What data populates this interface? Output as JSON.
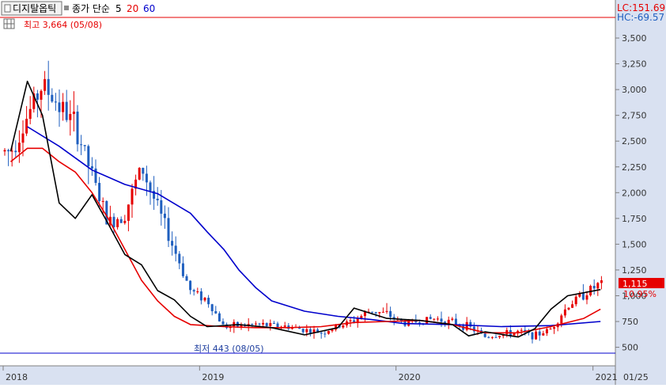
{
  "header": {
    "stock_name": "디지탈옵틱",
    "indicator_label": "종가 단순",
    "ma_periods": [
      "5",
      "20",
      "60"
    ],
    "lc_label": "LC:151.69",
    "hc_label": "HC:-69.57"
  },
  "annotations": {
    "high_label": "최고 3,664 (05/08)",
    "low_label": "최저 443 (08/05)",
    "current_price": "1,115",
    "current_change": "10.95%"
  },
  "colors": {
    "up": "#e60000",
    "down": "#1f5fbf",
    "ma5": "#000000",
    "ma20": "#e60000",
    "ma60": "#0000cc",
    "axis_bg": "#d9e1f1",
    "hc_color": "#1f5fbf"
  },
  "chart_data": {
    "type": "candlestick",
    "title": "",
    "yticks": [
      500,
      750,
      1000,
      1250,
      1500,
      1750,
      2000,
      2250,
      2500,
      2750,
      3000,
      3250,
      3500
    ],
    "ytick_labels": [
      "500",
      "750",
      "1,000",
      "1,250",
      "1,500",
      "1,750",
      "2,000",
      "2,250",
      "2,500",
      "2,750",
      "3,000",
      "3,250",
      "3,500"
    ],
    "ylim": [
      320,
      3700
    ],
    "x_labels": [
      "2018",
      "2019",
      "2020",
      "2021",
      "01/25"
    ],
    "high_value": 3664,
    "low_value": 443,
    "last_close": 1115,
    "series_close_key_points": [
      {
        "date": "2018-01",
        "close": 2400
      },
      {
        "date": "2018-03",
        "close": 3050
      },
      {
        "date": "2018-05",
        "close": 2650
      },
      {
        "date": "2018-07",
        "close": 1700
      },
      {
        "date": "2018-08",
        "close": 1800
      },
      {
        "date": "2018-09",
        "close": 2250
      },
      {
        "date": "2018-10",
        "close": 1850
      },
      {
        "date": "2018-11",
        "close": 1450
      },
      {
        "date": "2018-12",
        "close": 1050
      },
      {
        "date": "2019-01",
        "close": 960
      },
      {
        "date": "2019-02",
        "close": 700
      },
      {
        "date": "2019-04",
        "close": 720
      },
      {
        "date": "2019-06",
        "close": 700
      },
      {
        "date": "2019-08",
        "close": 640
      },
      {
        "date": "2019-10",
        "close": 760
      },
      {
        "date": "2019-11",
        "close": 860
      },
      {
        "date": "2019-12",
        "close": 820
      },
      {
        "date": "2020-01",
        "close": 730
      },
      {
        "date": "2020-03",
        "close": 780
      },
      {
        "date": "2020-05",
        "close": 700
      },
      {
        "date": "2020-06",
        "close": 600
      },
      {
        "date": "2020-08",
        "close": 650
      },
      {
        "date": "2020-09",
        "close": 610
      },
      {
        "date": "2020-10",
        "close": 680
      },
      {
        "date": "2020-11",
        "close": 900
      },
      {
        "date": "2020-12",
        "close": 1020
      },
      {
        "date": "2021-01",
        "close": 1115
      }
    ],
    "ma5_points": [
      {
        "date": "2018-01",
        "v": 2400
      },
      {
        "date": "2018-02",
        "v": 3080
      },
      {
        "date": "2018-03",
        "v": 2750
      },
      {
        "date": "2018-04",
        "v": 1900
      },
      {
        "date": "2018-05",
        "v": 1750
      },
      {
        "date": "2018-06",
        "v": 1980
      },
      {
        "date": "2018-07",
        "v": 1700
      },
      {
        "date": "2018-08",
        "v": 1400
      },
      {
        "date": "2018-09",
        "v": 1300
      },
      {
        "date": "2018-10",
        "v": 1050
      },
      {
        "date": "2018-11",
        "v": 960
      },
      {
        "date": "2018-12",
        "v": 800
      },
      {
        "date": "2019-01",
        "v": 700
      },
      {
        "date": "2019-03",
        "v": 720
      },
      {
        "date": "2019-05",
        "v": 690
      },
      {
        "date": "2019-07",
        "v": 620
      },
      {
        "date": "2019-09",
        "v": 690
      },
      {
        "date": "2019-10",
        "v": 880
      },
      {
        "date": "2019-12",
        "v": 780
      },
      {
        "date": "2020-02",
        "v": 760
      },
      {
        "date": "2020-04",
        "v": 720
      },
      {
        "date": "2020-05",
        "v": 610
      },
      {
        "date": "2020-06",
        "v": 650
      },
      {
        "date": "2020-08",
        "v": 600
      },
      {
        "date": "2020-09",
        "v": 680
      },
      {
        "date": "2020-10",
        "v": 870
      },
      {
        "date": "2020-11",
        "v": 1000
      },
      {
        "date": "2021-01",
        "v": 1060
      }
    ],
    "ma20_points": [
      {
        "date": "2018-01",
        "v": 2300
      },
      {
        "date": "2018-02",
        "v": 2430
      },
      {
        "date": "2018-03",
        "v": 2430
      },
      {
        "date": "2018-04",
        "v": 2300
      },
      {
        "date": "2018-05",
        "v": 2200
      },
      {
        "date": "2018-06",
        "v": 2000
      },
      {
        "date": "2018-07",
        "v": 1750
      },
      {
        "date": "2018-08",
        "v": 1450
      },
      {
        "date": "2018-09",
        "v": 1150
      },
      {
        "date": "2018-10",
        "v": 950
      },
      {
        "date": "2018-11",
        "v": 800
      },
      {
        "date": "2018-12",
        "v": 720
      },
      {
        "date": "2019-02",
        "v": 700
      },
      {
        "date": "2019-04",
        "v": 690
      },
      {
        "date": "2019-06",
        "v": 690
      },
      {
        "date": "2019-08",
        "v": 700
      },
      {
        "date": "2019-10",
        "v": 740
      },
      {
        "date": "2019-12",
        "v": 750
      },
      {
        "date": "2020-02",
        "v": 760
      },
      {
        "date": "2020-04",
        "v": 720
      },
      {
        "date": "2020-06",
        "v": 640
      },
      {
        "date": "2020-08",
        "v": 640
      },
      {
        "date": "2020-10",
        "v": 700
      },
      {
        "date": "2020-12",
        "v": 780
      },
      {
        "date": "2021-01",
        "v": 870
      }
    ],
    "ma60_points": [
      {
        "date": "2018-02",
        "v": 2640
      },
      {
        "date": "2018-04",
        "v": 2450
      },
      {
        "date": "2018-06",
        "v": 2220
      },
      {
        "date": "2018-08",
        "v": 2080
      },
      {
        "date": "2018-10",
        "v": 1990
      },
      {
        "date": "2018-12",
        "v": 1800
      },
      {
        "date": "2019-01",
        "v": 1620
      },
      {
        "date": "2019-02",
        "v": 1450
      },
      {
        "date": "2019-03",
        "v": 1250
      },
      {
        "date": "2019-04",
        "v": 1080
      },
      {
        "date": "2019-05",
        "v": 950
      },
      {
        "date": "2019-07",
        "v": 850
      },
      {
        "date": "2019-09",
        "v": 800
      },
      {
        "date": "2019-11",
        "v": 770
      },
      {
        "date": "2020-01",
        "v": 730
      },
      {
        "date": "2020-04",
        "v": 720
      },
      {
        "date": "2020-07",
        "v": 700
      },
      {
        "date": "2020-10",
        "v": 710
      },
      {
        "date": "2021-01",
        "v": 750
      }
    ],
    "current_price_line": 443
  }
}
